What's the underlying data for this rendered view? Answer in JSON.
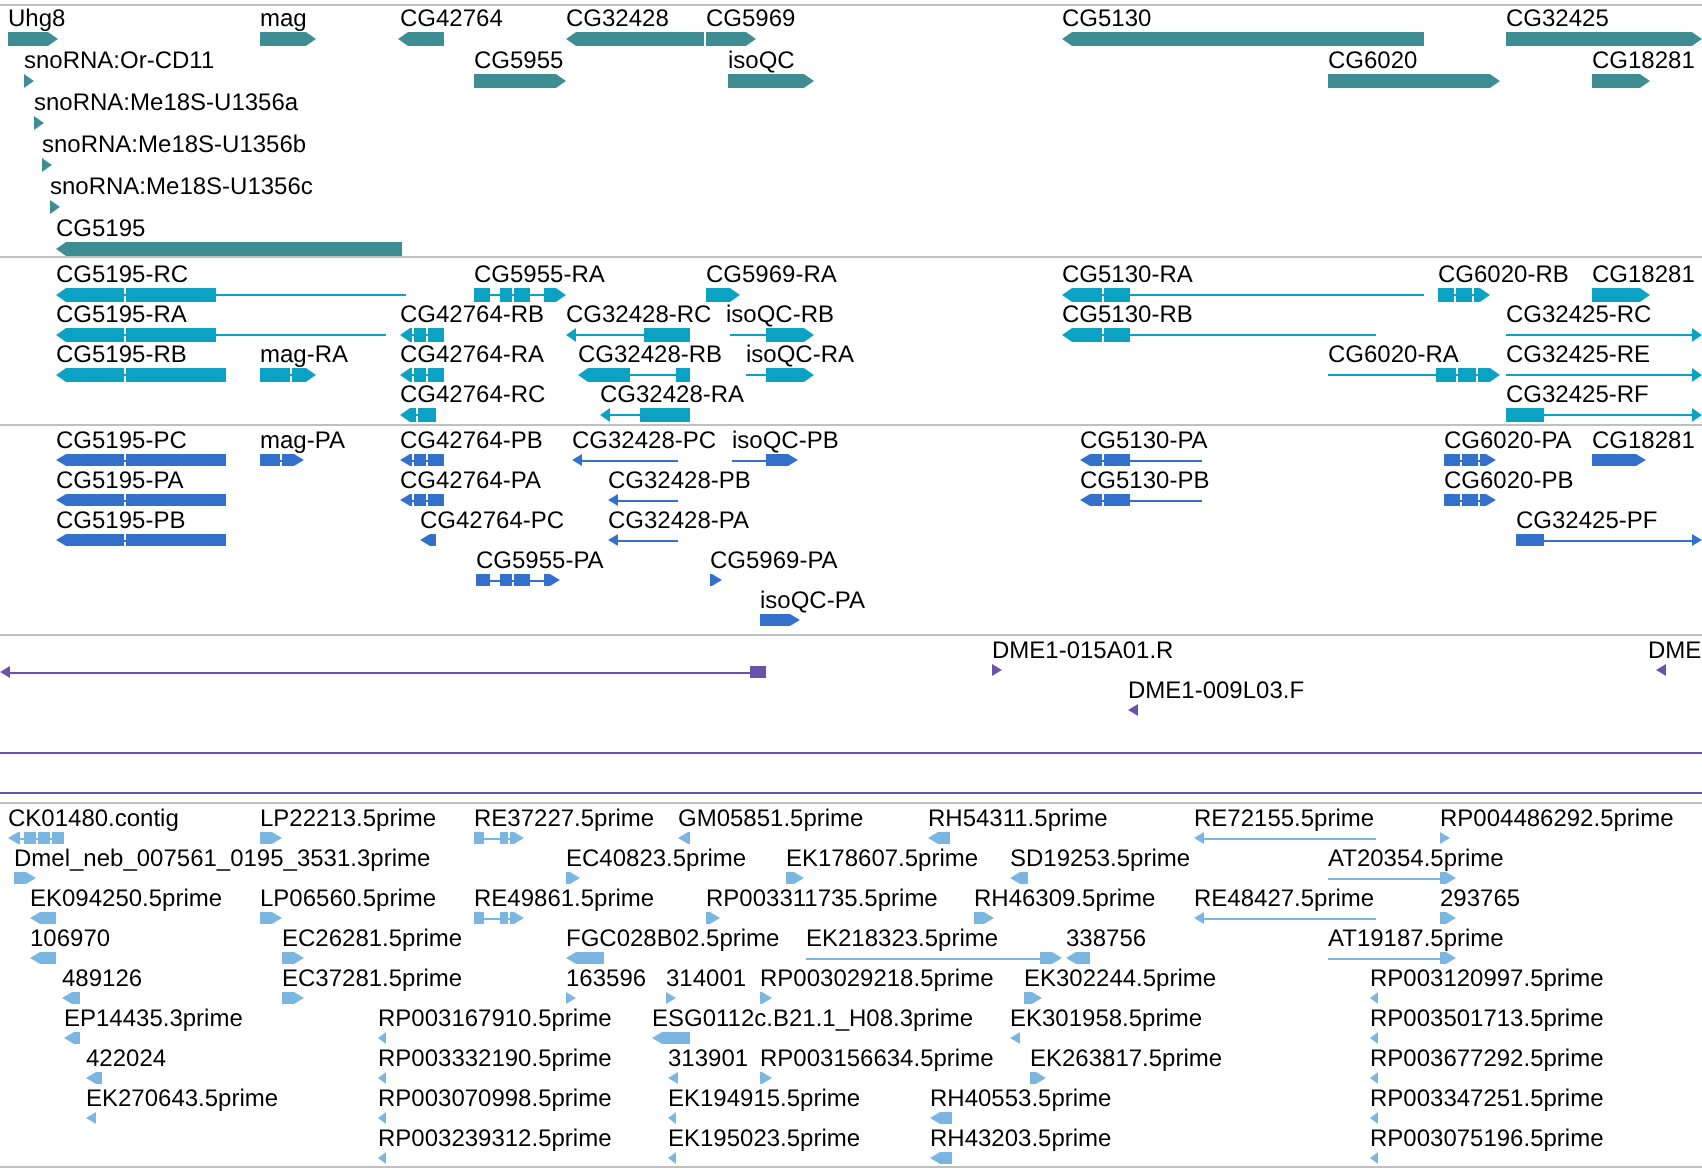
{
  "tracks": [
    {
      "kind": "gene",
      "features": [
        {
          "label": "Uhg8",
          "reverse": false
        },
        {
          "label": "mag",
          "reverse": false
        },
        {
          "label": "CG42764",
          "reverse": true
        },
        {
          "label": "CG32428",
          "reverse": true
        },
        {
          "label": "CG5969",
          "reverse": false
        },
        {
          "label": "CG5130",
          "reverse": true
        },
        {
          "label": "CG32425",
          "reverse": false
        },
        {
          "label": "snoRNA:Or-CD11",
          "reverse": false
        },
        {
          "label": "CG5955",
          "reverse": false
        },
        {
          "label": "isoQC",
          "reverse": false
        },
        {
          "label": "CG6020",
          "reverse": false
        },
        {
          "label": "CG18281",
          "reverse": false
        },
        {
          "label": "snoRNA:Me18S-U1356a",
          "reverse": false
        },
        {
          "label": "snoRNA:Me18S-U1356b",
          "reverse": false
        },
        {
          "label": "snoRNA:Me18S-U1356c",
          "reverse": false
        },
        {
          "label": "CG5195",
          "reverse": true
        }
      ]
    },
    {
      "kind": "transcript",
      "features": [
        {
          "label": "CG5195-RC",
          "reverse": true
        },
        {
          "label": "CG5955-RA",
          "reverse": false
        },
        {
          "label": "CG5969-RA",
          "reverse": false
        },
        {
          "label": "CG5130-RA",
          "reverse": true
        },
        {
          "label": "CG6020-RB",
          "reverse": false
        },
        {
          "label": "CG18281",
          "reverse": false
        },
        {
          "label": "CG5195-RA",
          "reverse": true
        },
        {
          "label": "CG42764-RB",
          "reverse": true
        },
        {
          "label": "CG32428-RC",
          "reverse": true
        },
        {
          "label": "isoQC-RB",
          "reverse": false
        },
        {
          "label": "CG5130-RB",
          "reverse": true
        },
        {
          "label": "CG32425-RC",
          "reverse": false
        },
        {
          "label": "CG5195-RB",
          "reverse": true
        },
        {
          "label": "mag-RA",
          "reverse": false
        },
        {
          "label": "CG42764-RA",
          "reverse": true
        },
        {
          "label": "CG32428-RB",
          "reverse": true
        },
        {
          "label": "isoQC-RA",
          "reverse": false
        },
        {
          "label": "CG6020-RA",
          "reverse": false
        },
        {
          "label": "CG32425-RE",
          "reverse": false
        },
        {
          "label": "CG42764-RC",
          "reverse": true
        },
        {
          "label": "CG32428-RA",
          "reverse": true
        },
        {
          "label": "CG32425-RF",
          "reverse": false
        }
      ]
    },
    {
      "kind": "protein",
      "features": [
        {
          "label": "CG5195-PC",
          "reverse": true
        },
        {
          "label": "mag-PA",
          "reverse": false
        },
        {
          "label": "CG42764-PB",
          "reverse": true
        },
        {
          "label": "CG32428-PC",
          "reverse": true
        },
        {
          "label": "isoQC-PB",
          "reverse": false
        },
        {
          "label": "CG5130-PA",
          "reverse": true
        },
        {
          "label": "CG6020-PA",
          "reverse": false
        },
        {
          "label": "CG18281",
          "reverse": false
        },
        {
          "label": "CG5195-PA",
          "reverse": true
        },
        {
          "label": "CG42764-PA",
          "reverse": true
        },
        {
          "label": "CG32428-PB",
          "reverse": true
        },
        {
          "label": "CG5130-PB",
          "reverse": true
        },
        {
          "label": "CG6020-PB",
          "reverse": false
        },
        {
          "label": "CG5195-PB",
          "reverse": true
        },
        {
          "label": "CG42764-PC",
          "reverse": true
        },
        {
          "label": "CG32428-PA",
          "reverse": true
        },
        {
          "label": "CG32425-PF",
          "reverse": false
        },
        {
          "label": "CG5955-PA",
          "reverse": false
        },
        {
          "label": "CG5969-PA",
          "reverse": false
        },
        {
          "label": "isoQC-PA",
          "reverse": false
        }
      ]
    },
    {
      "kind": "clone",
      "features": [
        {
          "reverse": true
        },
        {
          "label": "DME1-015A01.R",
          "reverse": false
        },
        {
          "label": "DME1-009L03.F",
          "reverse": true
        },
        {
          "label": "DME",
          "reverse": true
        }
      ]
    },
    {
      "kind": "est",
      "features": [
        {
          "label": "CK01480.contig",
          "reverse": true
        },
        {
          "label": "LP22213.5prime",
          "reverse": false
        },
        {
          "label": "RE37227.5prime",
          "reverse": false
        },
        {
          "label": "GM05851.5prime",
          "reverse": true
        },
        {
          "label": "RH54311.5prime",
          "reverse": true
        },
        {
          "label": "RE72155.5prime",
          "reverse": true
        },
        {
          "label": "RP004486292.5prime",
          "reverse": false
        },
        {
          "label": "Dmel_neb_007561_0195_3531.3prime",
          "reverse": false
        },
        {
          "label": "EC40823.5prime",
          "reverse": false
        },
        {
          "label": "EK178607.5prime",
          "reverse": false
        },
        {
          "label": "SD19253.5prime",
          "reverse": true
        },
        {
          "label": "AT20354.5prime",
          "reverse": false
        },
        {
          "label": "EK094250.5prime",
          "reverse": true
        },
        {
          "label": "LP06560.5prime",
          "reverse": false
        },
        {
          "label": "RE49861.5prime",
          "reverse": false
        },
        {
          "label": "RP003311735.5prime",
          "reverse": false
        },
        {
          "label": "RH46309.5prime",
          "reverse": false
        },
        {
          "label": "RE48427.5prime",
          "reverse": true
        },
        {
          "label": "293765",
          "reverse": false
        },
        {
          "label": "106970",
          "reverse": true
        },
        {
          "label": "EC26281.5prime",
          "reverse": false
        },
        {
          "label": "FGC028B02.5prime",
          "reverse": true
        },
        {
          "label": "EK218323.5prime",
          "reverse": false
        },
        {
          "label": "338756",
          "reverse": true
        },
        {
          "label": "AT19187.5prime",
          "reverse": false
        },
        {
          "label": "489126",
          "reverse": true
        },
        {
          "label": "EC37281.5prime",
          "reverse": false
        },
        {
          "label": "163596",
          "reverse": false
        },
        {
          "label": "314001",
          "reverse": false
        },
        {
          "label": "RP003029218.5prime",
          "reverse": false
        },
        {
          "label": "EK302244.5prime",
          "reverse": false
        },
        {
          "label": "RP003120997.5prime",
          "reverse": true
        },
        {
          "label": "EP14435.3prime",
          "reverse": true
        },
        {
          "label": "RP003167910.5prime",
          "reverse": true
        },
        {
          "label": "ESG0112c.B21.1_H08.3prime",
          "reverse": true
        },
        {
          "label": "EK301958.5prime",
          "reverse": true
        },
        {
          "label": "RP003501713.5prime",
          "reverse": true
        },
        {
          "label": "422024",
          "reverse": true
        },
        {
          "label": "RP003332190.5prime",
          "reverse": true
        },
        {
          "label": "313901",
          "reverse": true
        },
        {
          "label": "RP003156634.5prime",
          "reverse": false
        },
        {
          "label": "EK263817.5prime",
          "reverse": false
        },
        {
          "label": "RP003677292.5prime",
          "reverse": true
        },
        {
          "label": "EK270643.5prime",
          "reverse": true
        },
        {
          "label": "RP003070998.5prime",
          "reverse": true
        },
        {
          "label": "EK194915.5prime",
          "reverse": true
        },
        {
          "label": "RH40553.5prime",
          "reverse": true
        },
        {
          "label": "RP003347251.5prime",
          "reverse": true
        },
        {
          "label": "RP003239312.5prime",
          "reverse": true
        },
        {
          "label": "EK195023.5prime",
          "reverse": true
        },
        {
          "label": "RH43203.5prime",
          "reverse": true
        },
        {
          "label": "RP003075196.5prime",
          "reverse": true
        }
      ]
    }
  ]
}
